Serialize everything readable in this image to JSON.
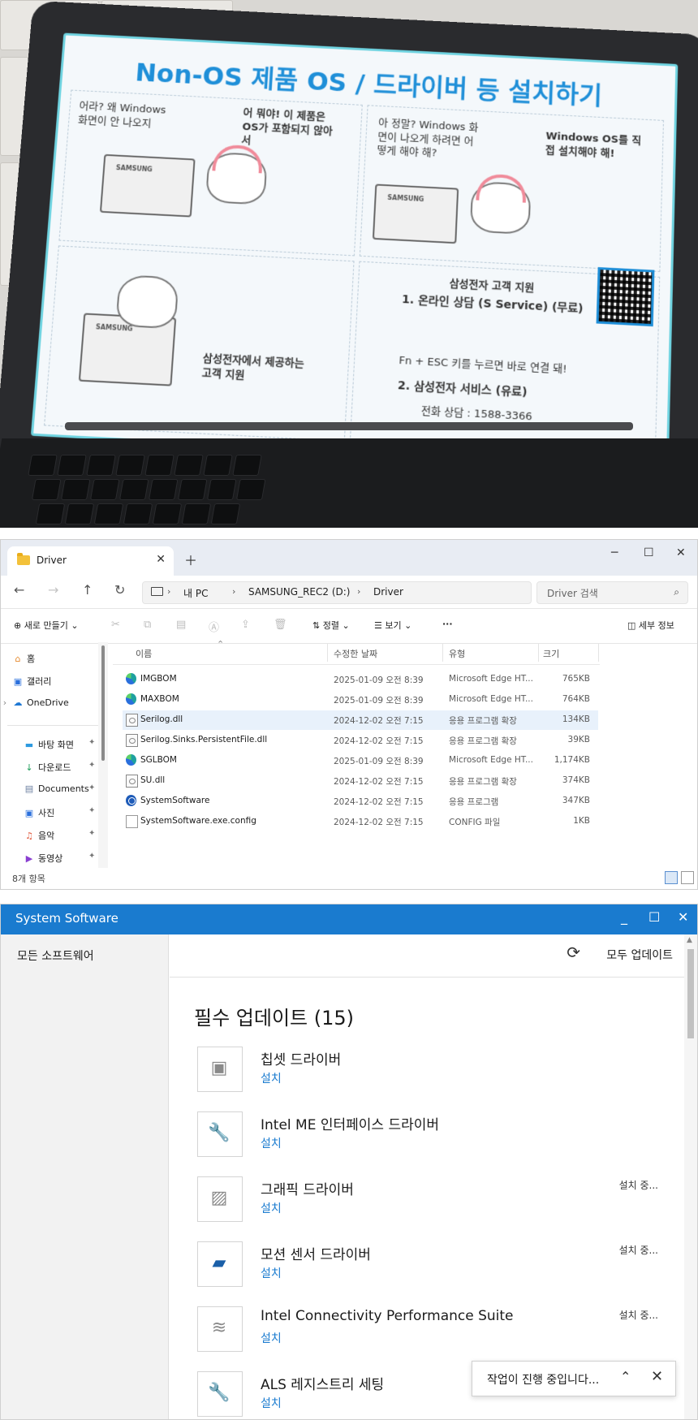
{
  "photo": {
    "poster_title": "Non-OS 제품 OS / 드라이버 등 설치하기",
    "panel1_thought": "어라? 왜 Windows 화면이 안 나오지",
    "panel1_box": "어 뭐야! 이 제품은 OS가 포함되지 않아서",
    "panel2_thought": "아 정말? Windows 화면이 나오게 하려면 어떻게 해야 해?",
    "panel3_box": "Windows OS를 직접 설치해야 해!",
    "panel4_box": "삼성전자에서 제공하는 고객 지원",
    "support_heading": "삼성전자 고객 지원",
    "support_item1": "1. 온라인 상담 (S Service) (무료)",
    "support_line1": "Fn + ESC 키를 누르면 바로 연결 돼!",
    "support_item2": "2. 삼성전자 서비스 (유료)",
    "support_phone": "전화 상담 : 1588-3366",
    "laptop_brand": "SAMSUNG"
  },
  "explorer": {
    "tab_title": "Driver",
    "breadcrumb": [
      "내 PC",
      "SAMSUNG_REC2 (D:)",
      "Driver"
    ],
    "search_placeholder": "Driver 검색",
    "toolbar": {
      "new": "새로 만들기",
      "sort": "정렬",
      "view": "보기",
      "more": "···",
      "details": "세부 정보"
    },
    "sidebar": [
      {
        "label": "홈",
        "icon": "home-icon",
        "pinned": false
      },
      {
        "label": "갤러리",
        "icon": "gallery-icon",
        "pinned": false
      },
      {
        "label": "OneDrive",
        "icon": "cloud-icon",
        "pinned": false
      },
      {
        "label": "바탕 화면",
        "icon": "desktop-icon",
        "pinned": true
      },
      {
        "label": "다운로드",
        "icon": "download-icon",
        "pinned": true
      },
      {
        "label": "Documents",
        "icon": "documents-icon",
        "pinned": true
      },
      {
        "label": "사진",
        "icon": "pictures-icon",
        "pinned": true
      },
      {
        "label": "음악",
        "icon": "music-icon",
        "pinned": true
      },
      {
        "label": "동영상",
        "icon": "videos-icon",
        "pinned": true
      }
    ],
    "columns": [
      "이름",
      "수정한 날짜",
      "유형",
      "크기"
    ],
    "files": [
      {
        "name": "IMGBOM",
        "date": "2025-01-09 오전 8:39",
        "type": "Microsoft Edge HT...",
        "size": "765KB",
        "icon": "edge-html-icon"
      },
      {
        "name": "MAXBOM",
        "date": "2025-01-09 오전 8:39",
        "type": "Microsoft Edge HT...",
        "size": "764KB",
        "icon": "edge-html-icon"
      },
      {
        "name": "Serilog.dll",
        "date": "2024-12-02 오전 7:15",
        "type": "응용 프로그램 확장",
        "size": "134KB",
        "icon": "dll-icon"
      },
      {
        "name": "Serilog.Sinks.PersistentFile.dll",
        "date": "2024-12-02 오전 7:15",
        "type": "응용 프로그램 확장",
        "size": "39KB",
        "icon": "dll-icon"
      },
      {
        "name": "SGLBOM",
        "date": "2025-01-09 오전 8:39",
        "type": "Microsoft Edge HT...",
        "size": "1,174KB",
        "icon": "edge-html-icon"
      },
      {
        "name": "SU.dll",
        "date": "2024-12-02 오전 7:15",
        "type": "응용 프로그램 확장",
        "size": "374KB",
        "icon": "dll-icon"
      },
      {
        "name": "SystemSoftware",
        "date": "2024-12-02 오전 7:15",
        "type": "응용 프로그램",
        "size": "347KB",
        "icon": "app-icon"
      },
      {
        "name": "SystemSoftware.exe.config",
        "date": "2024-12-02 오전 7:15",
        "type": "CONFIG 파일",
        "size": "1KB",
        "icon": "config-file-icon"
      }
    ],
    "status": "8개 항목"
  },
  "syssw": {
    "title": "System Software",
    "nav_all": "모든 소프트웨어",
    "update_all": "모두 업데이트",
    "heading": "필수 업데이트 (15)",
    "drivers": [
      {
        "name": "칩셋 드라이버",
        "action": "설치",
        "state": "",
        "icon": "chip-icon"
      },
      {
        "name": "Intel ME 인터페이스 드라이버",
        "action": "설치",
        "state": "",
        "icon": "wrench-icon"
      },
      {
        "name": "그래픽 드라이버",
        "action": "설치",
        "state": "설치 중...",
        "icon": "image-icon"
      },
      {
        "name": "모션 센서 드라이버",
        "action": "설치",
        "state": "설치 중...",
        "icon": "folder-icon"
      },
      {
        "name": "Intel Connectivity Performance Suite",
        "action": "설치",
        "state": "설치 중...",
        "icon": "wifi-icon"
      },
      {
        "name": "ALS 레지스트리 세팅",
        "action": "설치",
        "state": "",
        "icon": "wrench-icon"
      }
    ],
    "toast": "작업이 진행 중입니다..."
  }
}
